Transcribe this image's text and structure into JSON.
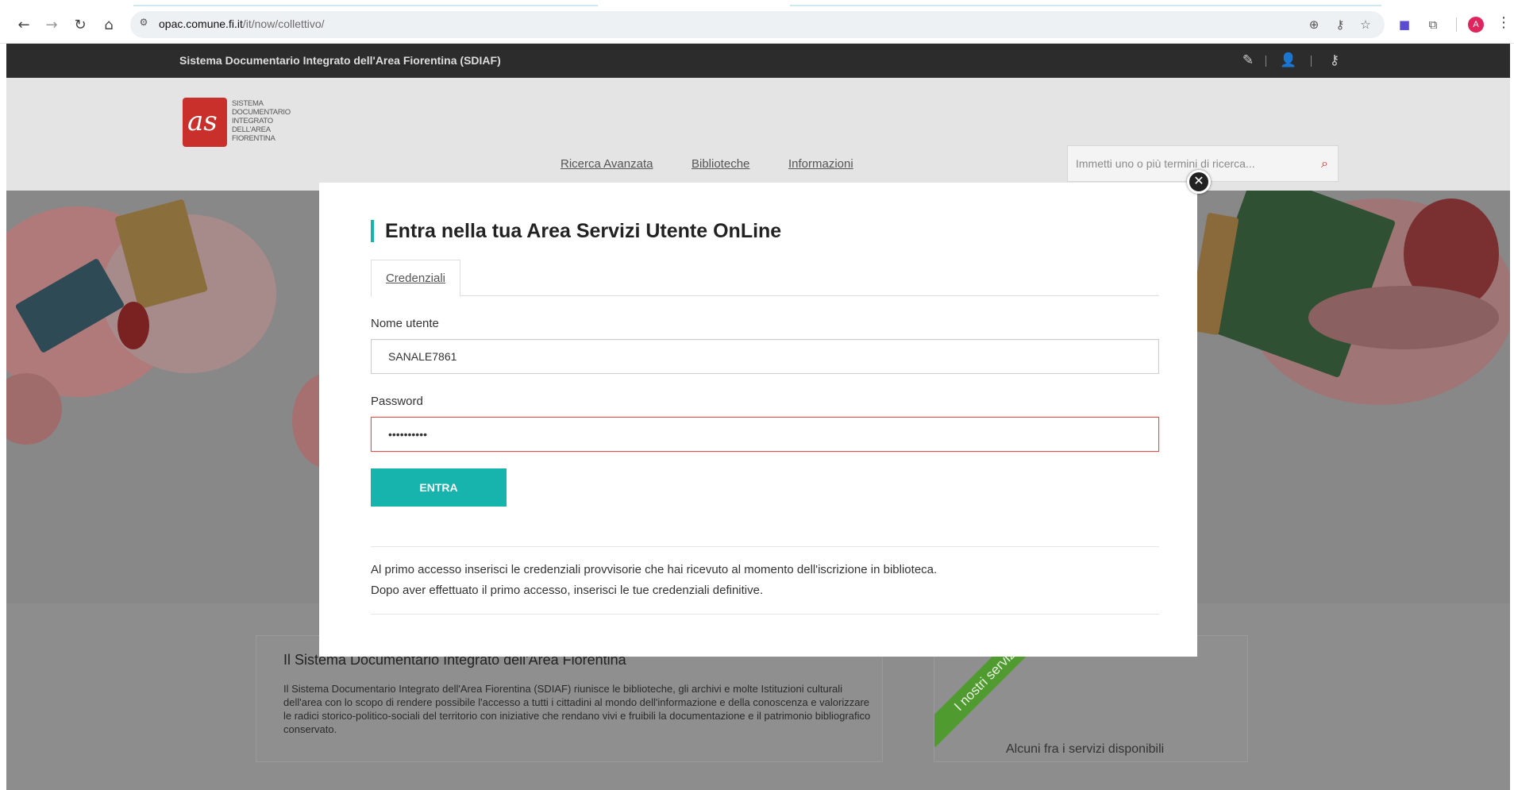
{
  "browser": {
    "url_host": "opac.comune.fi.it",
    "url_path": "/it/now/collettivo/",
    "profile_initial": "A"
  },
  "site": {
    "top_title": "Sistema Documentario Integrato dell'Area Fiorentina (SDIAF)",
    "logo_text": [
      "SISTEMA",
      "DOCUMENTARIO",
      "INTEGRATO",
      "DELL'AREA",
      "FIORENTINA"
    ],
    "nav": [
      "Ricerca Avanzata",
      "Biblioteche",
      "Informazioni"
    ],
    "search_placeholder": "Immetti uno o più termini di ricerca..."
  },
  "modal": {
    "title": "Entra nella tua Area Servizi Utente OnLine",
    "tab": "Credenziali",
    "username_label": "Nome utente",
    "username_value": "SANALE7861",
    "password_label": "Password",
    "password_value": "••••••••••",
    "submit_label": "ENTRA",
    "note_1": "Al primo accesso inserisci le credenziali provvisorie che hai ricevuto al momento dell'iscrizione in biblioteca.",
    "note_2": "Dopo aver effettuato il primo accesso, inserisci le tue credenziali definitive."
  },
  "content": {
    "intro_title": "Il Sistema Documentario Integrato dell'Area Fiorentina",
    "intro_text": "Il Sistema Documentario Integrato dell'Area Fiorentina (SDIAF) riunisce le biblioteche, gli archivi e molte Istituzioni culturali dell'area con lo scopo di rendere possibile l'accesso a tutti i cittadini al mondo dell'informazione e della conoscenza e valorizzare le radici storico-politico-sociali del territorio con iniziative che rendano vivi e fruibili la documentazione e il patrimonio bibliografico conservato.",
    "ribbon": "I nostri servizi",
    "services_sub": "Alcuni fra i servizi disponibili"
  },
  "colors": {
    "accent": "#17b3ad",
    "brand_red": "#c9302c",
    "error_border": "#d9534f",
    "ribbon_green": "#4f9b2f"
  }
}
